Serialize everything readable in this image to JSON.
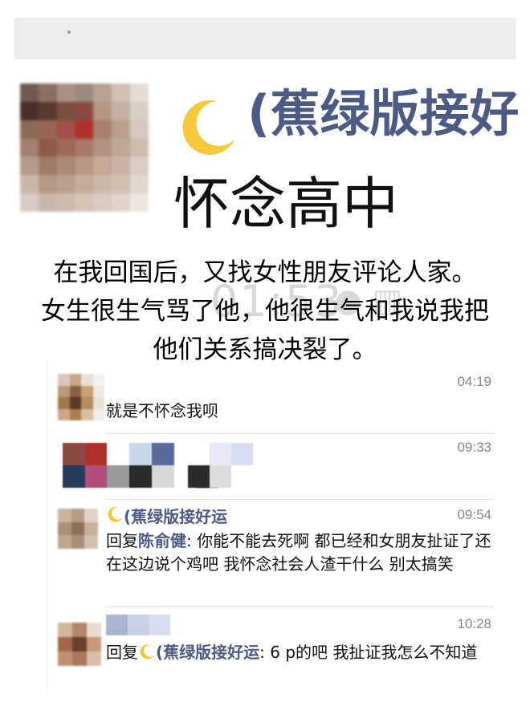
{
  "header": {
    "group_name": "(蕉绿版接好",
    "group_title": "怀念高中",
    "moon_icon": "crescent-moon-icon",
    "background_time": "01:53"
  },
  "caption": {
    "line1": "在我回国后，又找女性朋友评论人家。",
    "line2": "女生很生气骂了他，他很生气和我说我把",
    "line3": "他们关系搞决裂了。"
  },
  "messages": [
    {
      "time": "04:19",
      "text": "就是不怀念我呗"
    },
    {
      "time": "09:33"
    },
    {
      "time": "09:54",
      "author": "(蕉绿版接好运",
      "reply_prefix": "回复",
      "reply_to": "陈俞健",
      "text": ": 你能不能去死啊 都已经和女朋友扯证了还在这边说个鸡吧 我怀念社会人渣干什么 别太搞笑"
    },
    {
      "time": "10:28",
      "reply_prefix": "回复",
      "reply_to": "(蕉绿版接好运",
      "text": ": 6 p的吧 我扯证我怎么不知道"
    }
  ],
  "colors": {
    "name_blue": "#4e5a86",
    "moon_yellow": "#f5c93a",
    "time_gray": "#888888"
  }
}
